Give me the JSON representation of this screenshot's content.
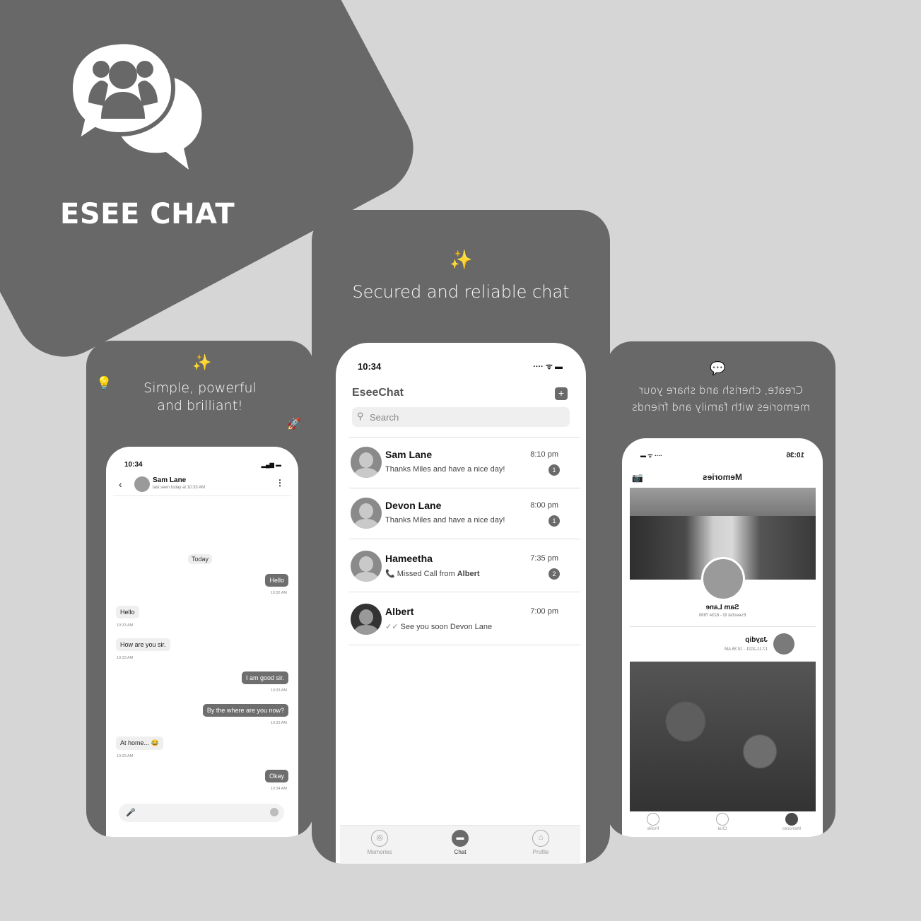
{
  "brand": {
    "name": "ESEE CHAT"
  },
  "left_card": {
    "caption_line1": "Simple, powerful",
    "caption_line2": "and brilliant!",
    "phone": {
      "time": "10:34",
      "contact_name": "Sam Lane",
      "contact_status": "last seen today at 10:33 AM",
      "date_divider": "Today",
      "messages": [
        {
          "text": "Hello",
          "time": "10:32 AM"
        },
        {
          "text": "Hello",
          "time": "10:33 AM"
        },
        {
          "text": "How are you sir.",
          "time": "10:33 AM"
        },
        {
          "text": "I am good sir.",
          "time": "10:33 AM"
        },
        {
          "text": "By the where are you now?",
          "time": "10:33 AM"
        },
        {
          "text": "At home...",
          "time": "10:33 AM"
        },
        {
          "text": "Okay",
          "time": "10:34 AM"
        }
      ]
    }
  },
  "center_card": {
    "caption": "Secured and reliable chat",
    "phone": {
      "time": "10:34",
      "app_title": "EseeChat",
      "search_placeholder": "Search",
      "chats": [
        {
          "name": "Sam Lane",
          "preview": "Thanks Miles and have a nice day!",
          "time": "8:10 pm",
          "badge": "1"
        },
        {
          "name": "Devon Lane",
          "preview": "Thanks Miles and have a nice day!",
          "time": "8:00 pm",
          "badge": "1"
        },
        {
          "name": "Hameetha",
          "preview_prefix": "Missed Call from ",
          "preview_bold": "Albert",
          "time": "7:35 pm",
          "badge": "2"
        },
        {
          "name": "Albert",
          "preview": "See you soon Devon Lane",
          "time": "7:00 pm",
          "badge": ""
        }
      ],
      "tabs": [
        {
          "label": "Memories"
        },
        {
          "label": "Chat"
        },
        {
          "label": "Profile"
        }
      ]
    }
  },
  "right_card": {
    "caption_line1": "Create, cherish and share your",
    "caption_line2": "memories with family and friends",
    "phone": {
      "time": "10:36",
      "title": "Memories",
      "profile_name": "Sam Lane",
      "profile_id": "Eseechat ID - 8234 7890",
      "post_author": "Jaydip",
      "post_date": "17-11-2021 - 10:35 AM",
      "tabs": [
        {
          "label": "Memories"
        },
        {
          "label": "Chat"
        },
        {
          "label": "Profile"
        }
      ]
    }
  }
}
